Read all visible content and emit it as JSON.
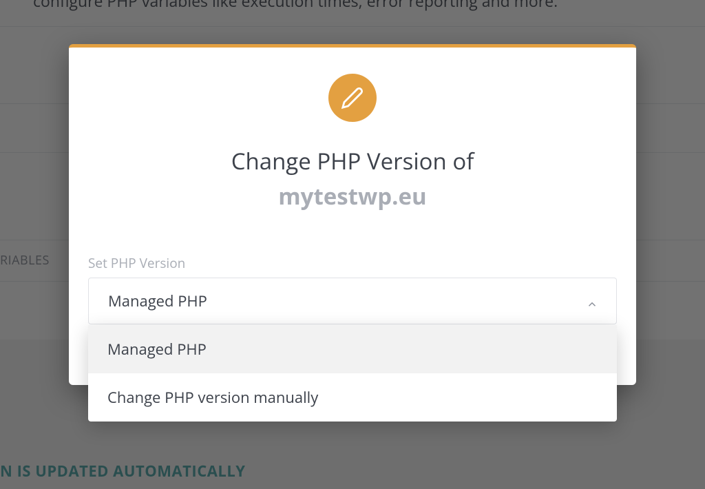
{
  "background": {
    "description_fragment": "configure PHP variables like execution times, error reporting and more.",
    "tab_label": "RIABLES",
    "banner_text": "N IS UPDATED AUTOMATICALLY"
  },
  "modal": {
    "icon": "pencil-icon",
    "title": "Change PHP Version of",
    "domain": "mytestwp.eu",
    "field_label": "Set PHP Version",
    "selected": "Managed PHP",
    "options": [
      "Managed PHP",
      "Change PHP version manually"
    ]
  },
  "colors": {
    "accent": "#E3A041",
    "teal": "#4CA6A8"
  }
}
